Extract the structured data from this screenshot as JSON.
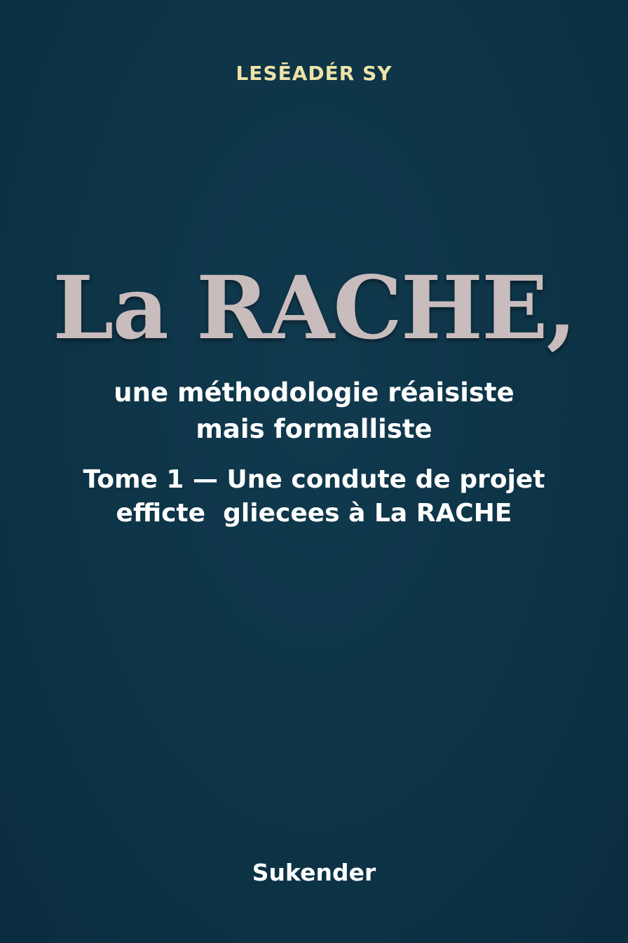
{
  "cover": {
    "author": "LESĒADÉR SY",
    "title": "La RACHE,",
    "subtitle_lines": [
      "une méthodologie réaisiste",
      "mais formalliste"
    ],
    "tome_lines": [
      "Tome 1 — Une condute de projet",
      "efficte  gliecees à La RACHE"
    ],
    "publisher": "Sukender"
  },
  "colors": {
    "background": "#0d3346",
    "title": "#c8bcbd",
    "author": "#ede3a8",
    "text": "#ffffff"
  }
}
